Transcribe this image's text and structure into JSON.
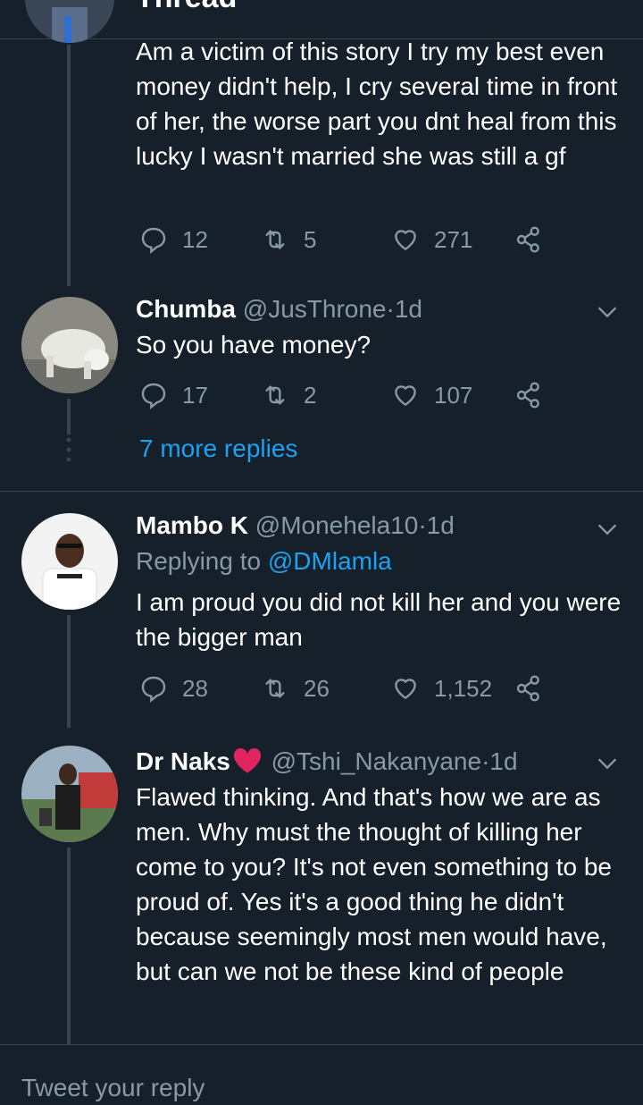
{
  "header": {
    "title": "Thread"
  },
  "tweets": [
    {
      "text": "Am a victim of this story I try my best even money didn't help, I cry several time in front of her, the worse part you dnt heal from this lucky I wasn't married she was still a gf",
      "replies": "12",
      "retweets": "5",
      "likes": "271"
    },
    {
      "name": "Chumba",
      "handle": "@JusThrone",
      "dot": "·",
      "time": "1d",
      "text": "So you have money?",
      "replies": "17",
      "retweets": "2",
      "likes": "107"
    },
    {
      "name": "Mambo K",
      "handle": "@Monehela10",
      "dot": "·",
      "time": "1d",
      "replying_prefix": "Replying to",
      "replying_to": "@DMlamla",
      "text": "I am proud you did not kill her and you were the bigger man",
      "replies": "28",
      "retweets": "26",
      "likes": "1,152"
    },
    {
      "name": "Dr Naks",
      "name_emoji": "heart-emoji",
      "handle": "@Tshi_Nakanyane",
      "dot": "·",
      "time": "1d",
      "text": "Flawed thinking. And that's how we are as men. Why must the thought of killing her come to you? It's not even something to be proud of. Yes it's a good thing he didn't because seemingly most men would have, but can we not be these kind of people"
    }
  ],
  "more_replies": "7 more replies",
  "reply_bar": {
    "placeholder": "Tweet your reply"
  },
  "colors": {
    "background": "#15202b",
    "secondary_text": "#8899a6",
    "link": "#1da1f2",
    "divider": "#38444d",
    "heart_red": "#e0245e"
  }
}
